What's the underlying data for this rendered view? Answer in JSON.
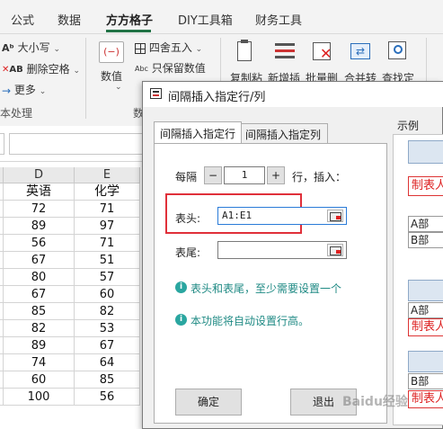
{
  "ribbon": {
    "tabs": [
      "公式",
      "数据",
      "方方格子",
      "DIY工具箱",
      "财务工具"
    ],
    "active_tab": "方方格子",
    "left_group": {
      "items": [
        "大小写",
        "删除空格",
        "更多"
      ],
      "group_label": "本处理"
    },
    "numeric_group": {
      "big_button": "数值",
      "items": [
        "四舍五入",
        "只保留数值"
      ],
      "group_label": "数"
    },
    "right_buttons": [
      "复制粘",
      "新增插",
      "批量删",
      "合并转",
      "查找定"
    ]
  },
  "sheet": {
    "columns": [
      "D",
      "E"
    ],
    "header_row": [
      "英语",
      "化学"
    ],
    "rows": [
      [
        "72",
        "71"
      ],
      [
        "89",
        "97"
      ],
      [
        "56",
        "71"
      ],
      [
        "67",
        "51"
      ],
      [
        "80",
        "57"
      ],
      [
        "67",
        "60"
      ],
      [
        "85",
        "82"
      ],
      [
        "82",
        "53"
      ],
      [
        "89",
        "67"
      ],
      [
        "74",
        "64"
      ],
      [
        "60",
        "85"
      ],
      [
        "100",
        "56"
      ]
    ]
  },
  "dialog": {
    "title": "间隔插入指定行/列",
    "tabs": [
      "间隔插入指定行",
      "间隔插入指定列"
    ],
    "active_tab": "间隔插入指定行",
    "every_label": "每隔",
    "minus_label": "−",
    "interval_value": "1",
    "plus_label": "+",
    "row_insert_label": "行，插入：",
    "header_label": "表头:",
    "header_value": "A1:E1",
    "footer_label": "表尾:",
    "footer_value": "",
    "hint1": "表头和表尾，至少需要设置一个",
    "hint2": "本功能将自动设置行高。",
    "confirm_button": "确定",
    "exit_button": "退出",
    "info_glyph": "i",
    "example_label": "示例",
    "example_lines": [
      "制表人",
      "A部",
      "B部",
      "A部",
      "制表人",
      "B部",
      "制表人"
    ]
  },
  "watermark": "Baidu经验",
  "colors": {
    "accent": "#217346",
    "highlight_border": "#e0303a",
    "info_icon": "#2aa6a0"
  }
}
